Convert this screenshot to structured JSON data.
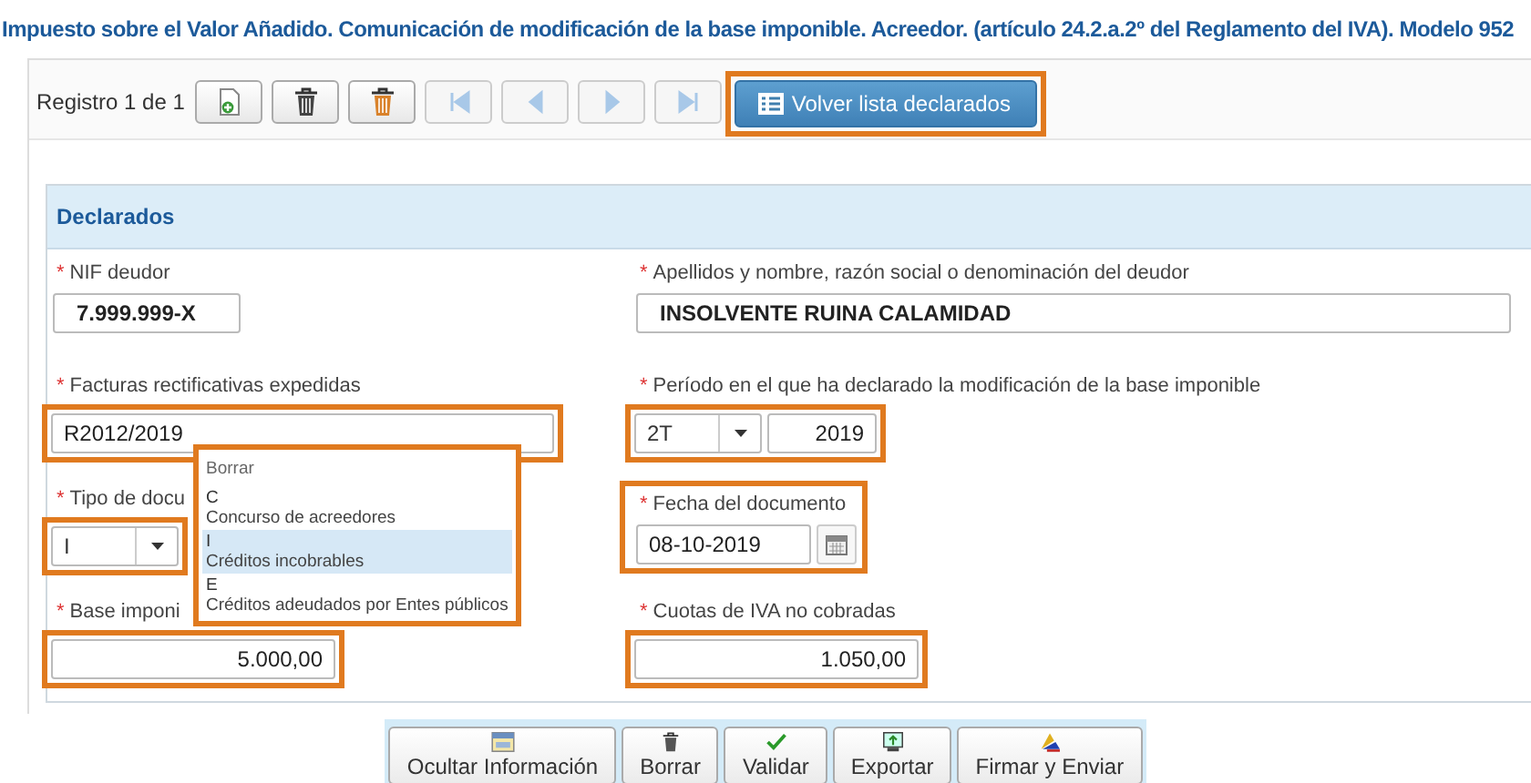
{
  "title": "Impuesto sobre el Valor Añadido. Comunicación de modificación de la base imponible. Acreedor. (artículo 24.2.a.2º del Reglamento del IVA). Modelo 952",
  "toolbar": {
    "record": "Registro 1 de 1",
    "buttons": [
      {
        "kind": "new",
        "disabled": false
      },
      {
        "kind": "delete",
        "disabled": false
      },
      {
        "kind": "delete-all",
        "disabled": false
      },
      {
        "kind": "first",
        "disabled": true
      },
      {
        "kind": "prev",
        "disabled": true
      },
      {
        "kind": "next",
        "disabled": true
      },
      {
        "kind": "last",
        "disabled": true
      }
    ],
    "back_button": {
      "label": "Volver lista declarados",
      "highlighted": true
    }
  },
  "section": {
    "title": "Declarados",
    "fields": [
      {
        "kind": "text",
        "required_mark": "*",
        "label": "NIF deudor",
        "value": "7.999.999-X",
        "bold": true,
        "highlighted": false
      },
      {
        "kind": "text",
        "required_mark": "*",
        "label": "Apellidos y nombre, razón social o denominación del deudor",
        "value": "INSOLVENTE RUINA CALAMIDAD",
        "bold": true,
        "highlighted": false
      },
      {
        "kind": "text",
        "required_mark": "*",
        "label": "Facturas rectificativas expedidas",
        "value": "R2012/2019",
        "bold": false,
        "highlighted": true
      },
      {
        "kind": "period",
        "required_mark": "*",
        "label": "Período en el que ha declarado la modificación de la base imponible",
        "value": "2T",
        "year": "2019",
        "highlighted": true
      },
      {
        "kind": "select",
        "required_mark": "*",
        "label": "Tipo de docu",
        "value": "I",
        "highlighted": true,
        "dropdown": [
          {
            "kind": "clear",
            "label": "Borrar",
            "selected": false
          },
          {
            "kind": "option",
            "code": "C",
            "label": "Concurso de acreedores",
            "selected": false
          },
          {
            "kind": "option",
            "code": "I",
            "label": "Créditos incobrables",
            "selected": true
          },
          {
            "kind": "option",
            "code": "E",
            "label": "Créditos adeudados por Entes públicos",
            "selected": false
          }
        ]
      },
      {
        "kind": "date",
        "required_mark": "*",
        "label": "Fecha del documento",
        "value": "08-10-2019",
        "highlighted": true
      },
      {
        "kind": "amount",
        "required_mark": "*",
        "label": "Base imponi",
        "value": "5.000,00",
        "highlighted": true
      },
      {
        "kind": "amount",
        "required_mark": "*",
        "label": "Cuotas de IVA no cobradas",
        "value": "1.050,00",
        "highlighted": true
      }
    ]
  },
  "actions": [
    {
      "kind": "hide",
      "label": "Ocultar Información"
    },
    {
      "kind": "delete",
      "label": "Borrar"
    },
    {
      "kind": "validate",
      "label": "Validar"
    },
    {
      "kind": "export",
      "label": "Exportar"
    },
    {
      "kind": "sign",
      "label": "Firmar y Enviar"
    }
  ]
}
